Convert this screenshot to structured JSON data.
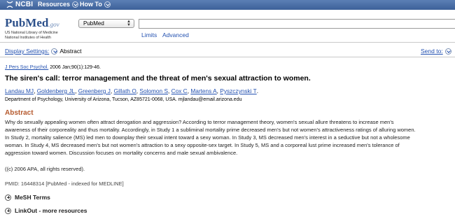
{
  "topbar": {
    "logo_text": "NCBI",
    "menus": [
      "Resources",
      "How To"
    ]
  },
  "header": {
    "logo_pub": "Pub",
    "logo_med": "Med",
    "logo_gov": ".gov",
    "sub_line1": "US National Library of Medicine",
    "sub_line2": "National Institutes of Health",
    "database_selected": "PubMed",
    "search_value": "",
    "links": [
      "Limits",
      "Advanced"
    ]
  },
  "display": {
    "settings_label": "Display Settings:",
    "format": "Abstract",
    "send_to": "Send to:"
  },
  "article": {
    "journal": "J Pers Soc Psychol.",
    "citation_rest": " 2006 Jan;90(1):129-46.",
    "title": "The siren's call: terror management and the threat of men's sexual attraction to women.",
    "authors": [
      "Landau MJ",
      "Goldenberg JL",
      "Greenberg J",
      "Gillath O",
      "Solomon S",
      "Cox C",
      "Martens A",
      "Pyszczynski T"
    ],
    "affiliation": "Department of Psychology, University of Arizona, Tucson, AZ85721-0068, USA. mjlandau@email.arizona.edu",
    "abstract_heading": "Abstract",
    "abstract_lines": [
      "Why do sexually appealing women often attract derogation and aggression? According to terror management theory, women's sexual allure threatens to increase men's",
      "awareness of their corporeality and thus mortality. Accordingly, in Study 1 a subliminal mortality prime decreased men's but not women's attractiveness ratings of alluring women.",
      "In Study 2, mortality salience (MS) led men to downplay their sexual intent toward a sexy woman. In Study 3, MS decreased men's interest in a seductive but not a wholesome",
      "woman. In Study 4, MS decreased men's but not women's attraction to a sexy opposite-sex target. In Study 5, MS and a corporeal lust prime increased men's tolerance of",
      "aggression toward women. Discussion focuses on mortality concerns and male sexual ambivalence."
    ],
    "copyright": "((c) 2006 APA, all rights reserved).",
    "pmid": "PMID: 16448314 [PubMed - indexed for MEDLINE]"
  },
  "sections": {
    "mesh": "MeSH Terms",
    "linkout": "LinkOut - more resources"
  }
}
